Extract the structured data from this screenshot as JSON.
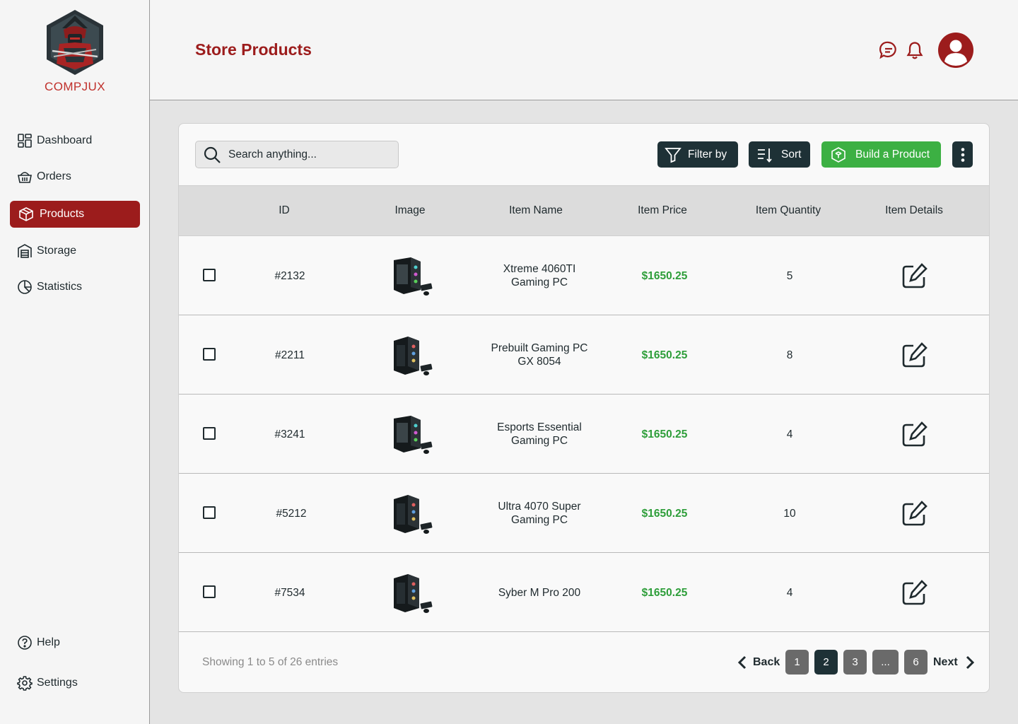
{
  "brand": {
    "name": "COMPJUX"
  },
  "sidebar": {
    "items": [
      {
        "label": "Dashboard",
        "icon": "dashboard-icon"
      },
      {
        "label": "Orders",
        "icon": "basket-icon"
      },
      {
        "label": "Products",
        "icon": "box-icon",
        "active": true
      },
      {
        "label": "Storage",
        "icon": "warehouse-icon"
      },
      {
        "label": "Statistics",
        "icon": "pie-chart-icon"
      }
    ],
    "bottom": [
      {
        "label": "Help",
        "icon": "help-icon"
      },
      {
        "label": "Settings",
        "icon": "gear-icon"
      }
    ]
  },
  "header": {
    "title": "Store Products"
  },
  "toolbar": {
    "search_placeholder": "Search anything...",
    "filter_label": "Filter by",
    "sort_label": "Sort",
    "build_label": "Build a Product"
  },
  "table": {
    "columns": [
      "ID",
      "Image",
      "Item Name",
      "Item Price",
      "Item Quantity",
      "Item Details"
    ],
    "rows": [
      {
        "id": "#2132",
        "name_line1": "Xtreme 4060TI",
        "name_line2": "Gaming PC",
        "price": "$1650.25",
        "qty": "5"
      },
      {
        "id": "#2211",
        "name_line1": "Prebuilt Gaming PC",
        "name_line2": "GX 8054",
        "price": "$1650.25",
        "qty": "8"
      },
      {
        "id": "#3241",
        "name_line1": "Esports Essential",
        "name_line2": "Gaming PC",
        "price": "$1650.25",
        "qty": "4"
      },
      {
        "id": "#5212",
        "name_line1": "Ultra 4070 Super",
        "name_line2": "Gaming PC",
        "price": "$1650.25",
        "qty": "10"
      },
      {
        "id": "#7534",
        "name_line1": "Syber M Pro 200",
        "name_line2": "",
        "price": "$1650.25",
        "qty": "4"
      }
    ]
  },
  "pagination": {
    "summary": "Showing 1 to 5 of 26 entries",
    "back_label": "Back",
    "next_label": "Next",
    "pages": [
      "1",
      "2",
      "3",
      "...",
      "6"
    ],
    "current_page": "2"
  },
  "colors": {
    "brand_red": "#9c1c1c",
    "dark_button": "#1e3136",
    "green_button": "#3cb043",
    "price_green": "#2e9e3a"
  }
}
